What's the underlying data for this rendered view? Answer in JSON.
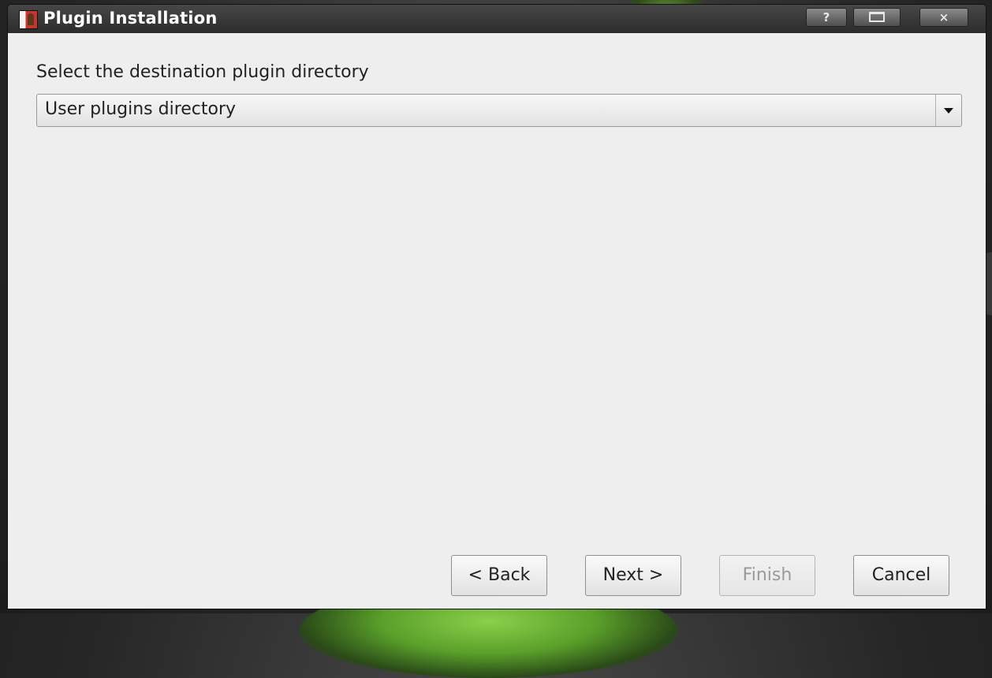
{
  "window": {
    "title": "Plugin Installation",
    "controls": {
      "help": "?",
      "maximize": "",
      "close": "×"
    }
  },
  "form": {
    "prompt": "Select the destination plugin directory",
    "directory_select": {
      "selected": "User plugins directory"
    }
  },
  "buttons": {
    "back": "< Back",
    "next": "Next >",
    "finish": "Finish",
    "cancel": "Cancel"
  }
}
